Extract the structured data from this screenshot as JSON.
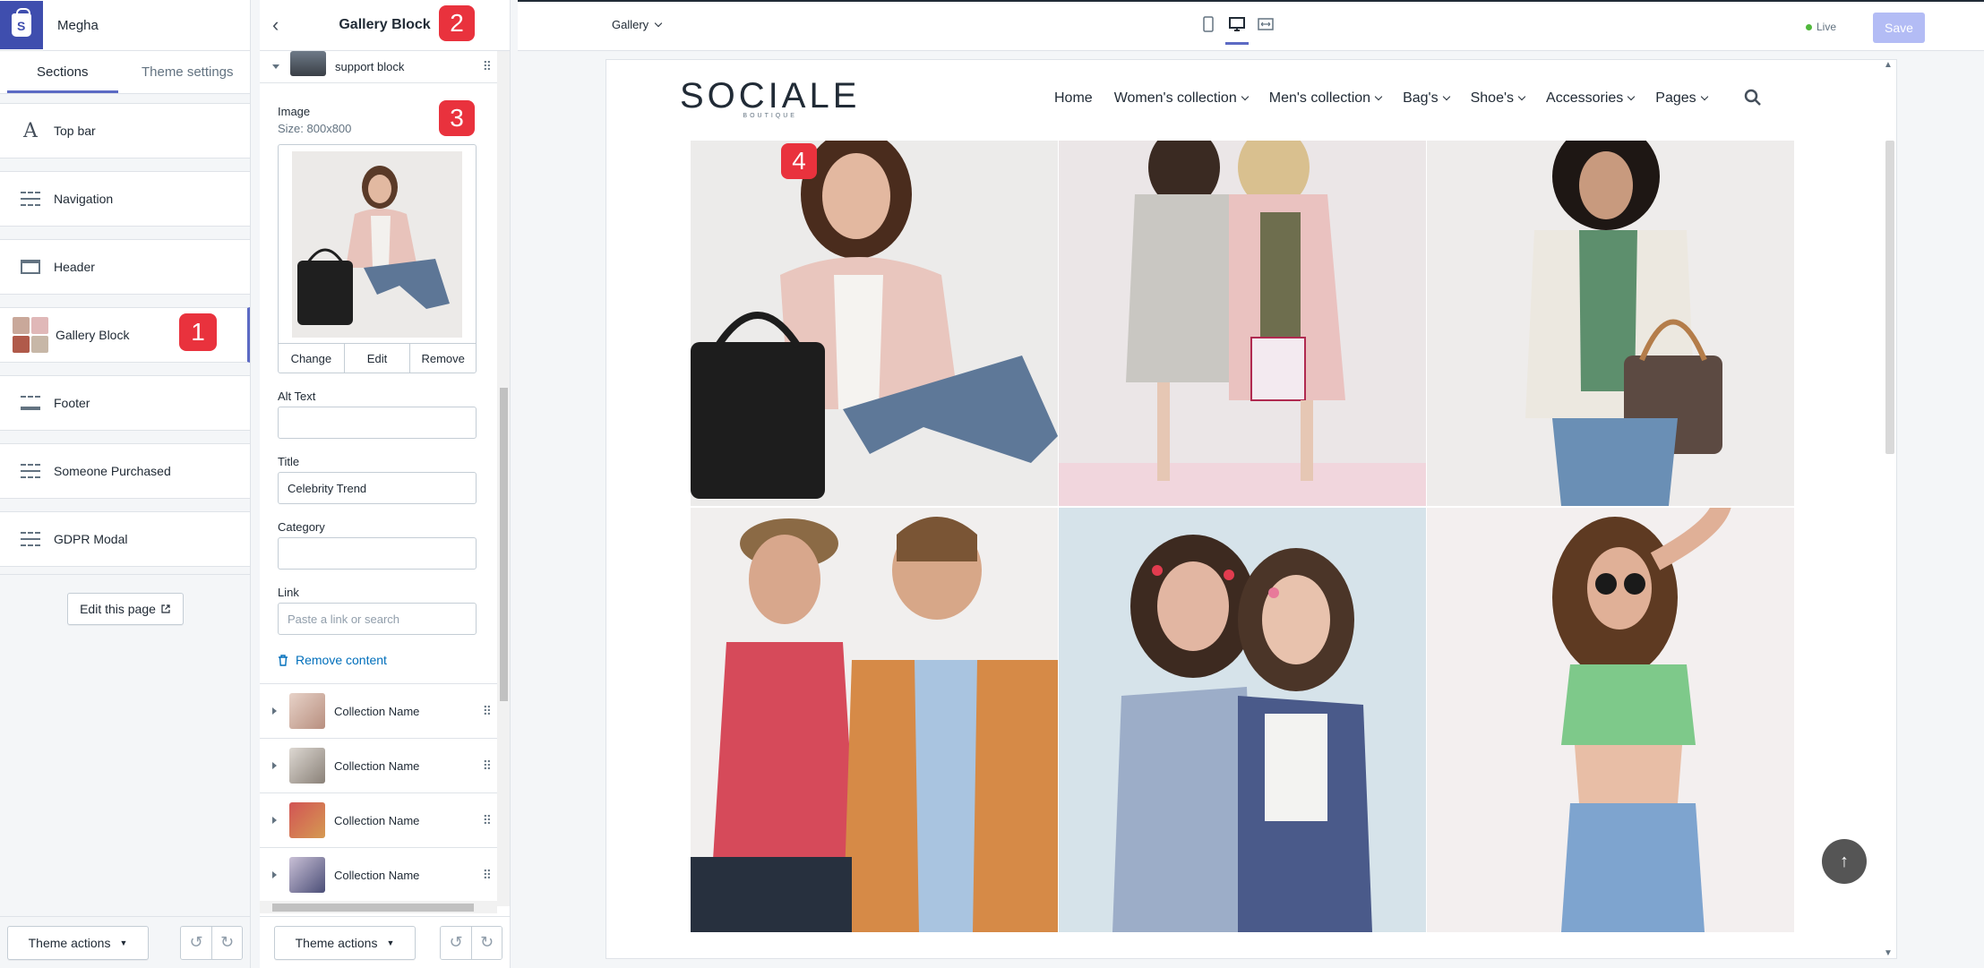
{
  "store": {
    "name": "Megha"
  },
  "sidebar": {
    "tabs": [
      {
        "label": "Sections"
      },
      {
        "label": "Theme settings"
      }
    ],
    "sections": [
      {
        "label": "Top bar",
        "icon": "text-A-icon"
      },
      {
        "label": "Navigation",
        "icon": "section-lines-icon"
      },
      {
        "label": "Header",
        "icon": "header-icon"
      },
      {
        "label": "Gallery Block",
        "icon": "gallery-thumbnail"
      },
      {
        "label": "Footer",
        "icon": "footer-icon"
      },
      {
        "label": "Someone Purchased",
        "icon": "section-lines-icon"
      },
      {
        "label": "GDPR Modal",
        "icon": "section-lines-icon"
      }
    ],
    "edit_page_label": "Edit this page",
    "theme_actions_label": "Theme actions"
  },
  "badges": {
    "b1": "1",
    "b2": "2",
    "b3": "3",
    "b4": "4"
  },
  "editor": {
    "title": "Gallery Block",
    "support_block_label": "support block",
    "image_label": "Image",
    "image_size": "Size: 800x800",
    "image_actions": {
      "change": "Change",
      "edit": "Edit",
      "remove": "Remove"
    },
    "alt_text_label": "Alt Text",
    "alt_text_value": "",
    "title_label": "Title",
    "title_value": "Celebrity Trend",
    "category_label": "Category",
    "category_value": "",
    "link_label": "Link",
    "link_placeholder": "Paste a link or search",
    "remove_content_label": "Remove content",
    "collections": [
      {
        "label": "Collection Name"
      },
      {
        "label": "Collection Name"
      },
      {
        "label": "Collection Name"
      },
      {
        "label": "Collection Name"
      }
    ],
    "theme_actions_label": "Theme actions"
  },
  "topbar": {
    "page_select": "Gallery",
    "status": "Live",
    "save_label": "Save"
  },
  "preview": {
    "logo": "SOCIALE",
    "logo_sub": "BOUTIQUE",
    "menu": [
      {
        "label": "Home",
        "dropdown": false
      },
      {
        "label": "Women's collection",
        "dropdown": true
      },
      {
        "label": "Men's collection",
        "dropdown": true
      },
      {
        "label": "Bag's",
        "dropdown": true
      },
      {
        "label": "Shoe's",
        "dropdown": true
      },
      {
        "label": "Accessories",
        "dropdown": true
      },
      {
        "label": "Pages",
        "dropdown": true
      }
    ]
  },
  "colors": {
    "accent": "#5c6ac4",
    "badge": "#e9323d",
    "shopify_logo": "#3f4eae",
    "live": "#50b83c",
    "save_disabled": "#b3bcf5"
  }
}
